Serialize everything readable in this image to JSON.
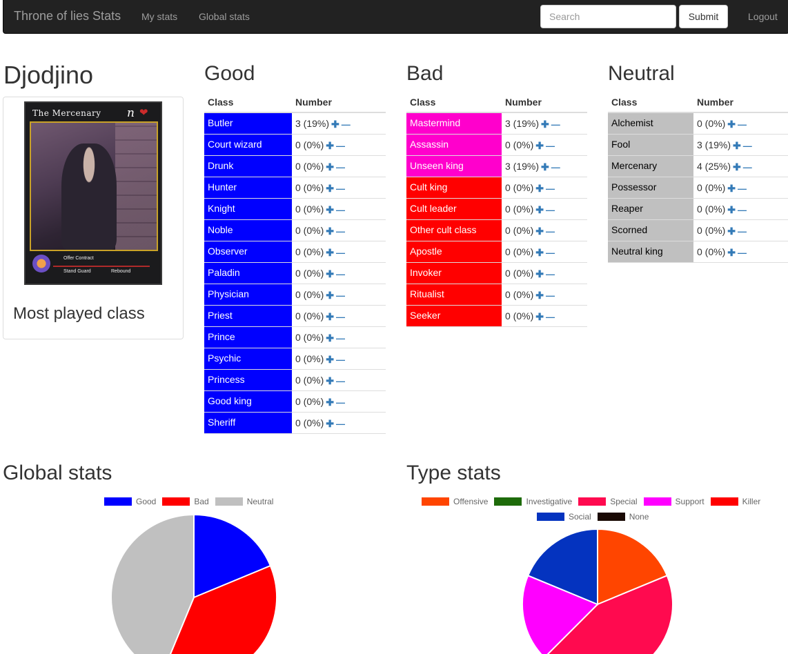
{
  "navbar": {
    "brand": "Throne of lies Stats",
    "links": [
      "My stats",
      "Global stats"
    ],
    "search_placeholder": "Search",
    "submit_label": "Submit",
    "logout_label": "Logout"
  },
  "player": {
    "name": "Djodjino",
    "card": {
      "title": "The Mercenary",
      "badge": "n",
      "abilities": [
        "Offer Contract",
        "Stand Guard",
        "Rebound"
      ]
    },
    "most_played_label": "Most played class"
  },
  "columns": {
    "class": "Class",
    "number": "Number"
  },
  "groups": [
    {
      "title": "Good",
      "color": "#0000ff",
      "text_color": "#ffffff",
      "rows": [
        {
          "cls": "Butler",
          "num": "3 (19%)"
        },
        {
          "cls": "Court wizard",
          "num": "0 (0%)"
        },
        {
          "cls": "Drunk",
          "num": "0 (0%)"
        },
        {
          "cls": "Hunter",
          "num": "0 (0%)"
        },
        {
          "cls": "Knight",
          "num": "0 (0%)"
        },
        {
          "cls": "Noble",
          "num": "0 (0%)"
        },
        {
          "cls": "Observer",
          "num": "0 (0%)"
        },
        {
          "cls": "Paladin",
          "num": "0 (0%)"
        },
        {
          "cls": "Physician",
          "num": "0 (0%)"
        },
        {
          "cls": "Priest",
          "num": "0 (0%)"
        },
        {
          "cls": "Prince",
          "num": "0 (0%)"
        },
        {
          "cls": "Psychic",
          "num": "0 (0%)"
        },
        {
          "cls": "Princess",
          "num": "0 (0%)"
        },
        {
          "cls": "Good king",
          "num": "0 (0%)"
        },
        {
          "cls": "Sheriff",
          "num": "0 (0%)"
        }
      ]
    },
    {
      "title": "Bad",
      "color": "#ff0000",
      "text_color": "#ffffff",
      "rows": [
        {
          "cls": "Mastermind",
          "num": "3 (19%)",
          "color": "#ff00cc"
        },
        {
          "cls": "Assassin",
          "num": "0 (0%)",
          "color": "#ff00cc"
        },
        {
          "cls": "Unseen king",
          "num": "3 (19%)",
          "color": "#ff00cc"
        },
        {
          "cls": "Cult king",
          "num": "0 (0%)"
        },
        {
          "cls": "Cult leader",
          "num": "0 (0%)"
        },
        {
          "cls": "Other cult class",
          "num": "0 (0%)"
        },
        {
          "cls": "Apostle",
          "num": "0 (0%)"
        },
        {
          "cls": "Invoker",
          "num": "0 (0%)"
        },
        {
          "cls": "Ritualist",
          "num": "0 (0%)"
        },
        {
          "cls": "Seeker",
          "num": "0 (0%)"
        }
      ]
    },
    {
      "title": "Neutral",
      "color": "#c0c0c0",
      "text_color": "#000000",
      "rows": [
        {
          "cls": "Alchemist",
          "num": "0 (0%)"
        },
        {
          "cls": "Fool",
          "num": "3 (19%)"
        },
        {
          "cls": "Mercenary",
          "num": "4 (25%)"
        },
        {
          "cls": "Possessor",
          "num": "0 (0%)"
        },
        {
          "cls": "Reaper",
          "num": "0 (0%)"
        },
        {
          "cls": "Scorned",
          "num": "0 (0%)"
        },
        {
          "cls": "Neutral king",
          "num": "0 (0%)"
        }
      ]
    }
  ],
  "chart_data": [
    {
      "type": "pie",
      "title": "Global stats",
      "labels": [
        "Good",
        "Bad",
        "Neutral"
      ],
      "values": [
        3,
        6,
        7
      ],
      "colors": [
        "#0000ff",
        "#ff0000",
        "#c0c0c0"
      ],
      "legend": "top"
    },
    {
      "type": "pie",
      "title": "Type stats",
      "labels": [
        "Offensive",
        "Investigative",
        "Special",
        "Support",
        "Killer",
        "Social",
        "None"
      ],
      "values": [
        3,
        0,
        7,
        3,
        0,
        3,
        0
      ],
      "colors": [
        "#ff4500",
        "#1e6b0a",
        "#ff0a4f",
        "#ff00ff",
        "#ff0000",
        "#0433bf",
        "#1a0a05"
      ],
      "legend": "top"
    }
  ]
}
